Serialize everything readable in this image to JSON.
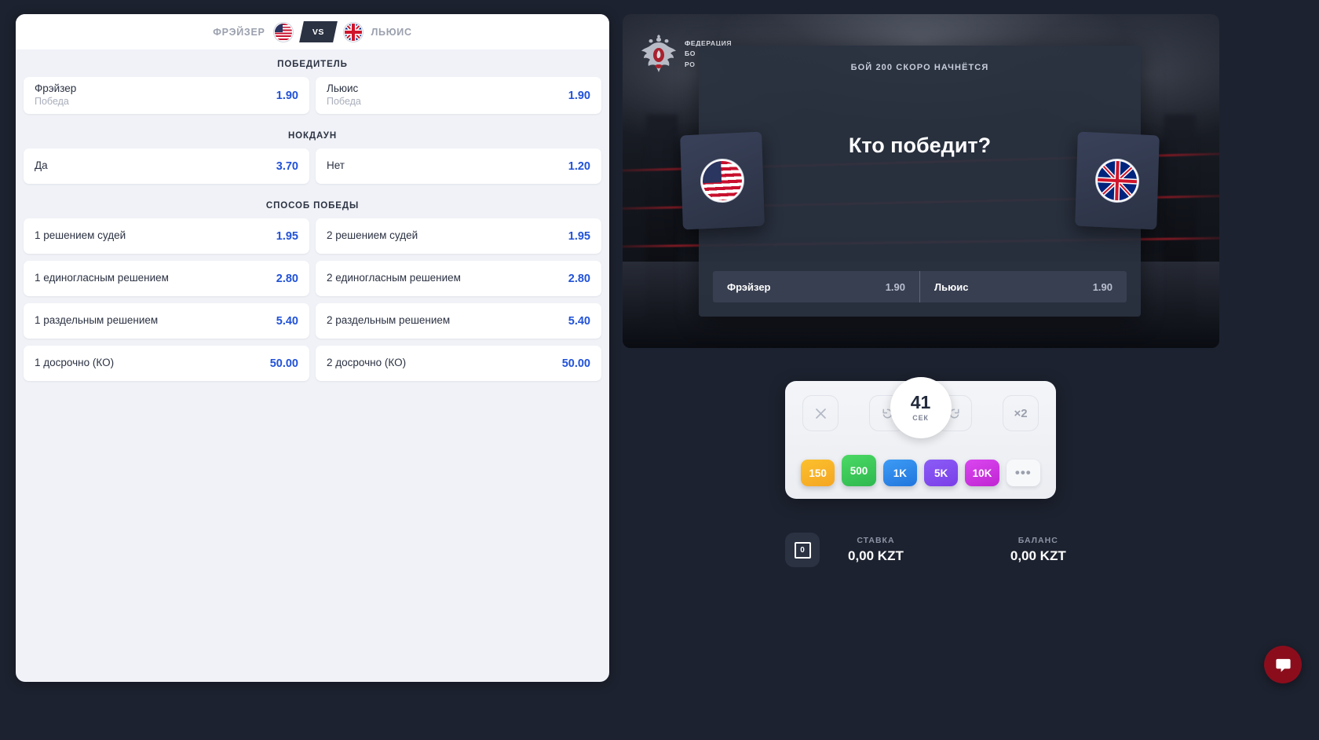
{
  "colors": {
    "accent_odds": "#2152d8",
    "panel_bg": "#f0f2f7",
    "dark_bg": "#1d2230",
    "overlay_bg": "#2a3140",
    "timer_ring": "#3dd13f",
    "chat_bubble": "#8b0d1c"
  },
  "bet_panel": {
    "header": {
      "fighter_left": "ФРЭЙЗЕР",
      "vs_label": "VS",
      "fighter_right": "ЛЬЮИС",
      "flag_left": "us-flag-icon",
      "flag_right": "uk-flag-icon"
    },
    "markets": [
      {
        "title": "ПОБЕДИТЕЛЬ",
        "rows": [
          [
            {
              "label": "Фрэйзер",
              "sub": "Победа",
              "odd": "1.90"
            },
            {
              "label": "Льюис",
              "sub": "Победа",
              "odd": "1.90"
            }
          ]
        ]
      },
      {
        "title": "НОКДАУН",
        "rows": [
          [
            {
              "label": "Да",
              "sub": "",
              "odd": "3.70"
            },
            {
              "label": "Нет",
              "sub": "",
              "odd": "1.20"
            }
          ]
        ]
      },
      {
        "title": "СПОСОБ ПОБЕДЫ",
        "rows": [
          [
            {
              "label": "1 решением судей",
              "sub": "",
              "odd": "1.95"
            },
            {
              "label": "2 решением судей",
              "sub": "",
              "odd": "1.95"
            }
          ],
          [
            {
              "label": "1 единогласным решением",
              "sub": "",
              "odd": "2.80"
            },
            {
              "label": "2 единогласным решением",
              "sub": "",
              "odd": "2.80"
            }
          ],
          [
            {
              "label": "1 раздельным решением",
              "sub": "",
              "odd": "5.40"
            },
            {
              "label": "2 раздельным решением",
              "sub": "",
              "odd": "5.40"
            }
          ],
          [
            {
              "label": "1 досрочно (КО)",
              "sub": "",
              "odd": "50.00"
            },
            {
              "label": "2 досрочно (КО)",
              "sub": "",
              "odd": "50.00"
            }
          ]
        ]
      }
    ]
  },
  "game": {
    "federation_logo": {
      "line1": "ФЕДЕРАЦИЯ",
      "line2": "БО",
      "line3": "РО",
      "emblem": "double-headed-eagle-icon"
    },
    "overlay": {
      "status_text": "БОЙ 200 СКОРО НАЧНЁТСЯ",
      "question": "Кто победит?",
      "card_left_flag": "us-flag-icon",
      "card_right_flag": "uk-flag-icon",
      "odds": [
        {
          "name": "Фрэйзер",
          "value": "1.90"
        },
        {
          "name": "Льюис",
          "value": "1.90"
        }
      ]
    }
  },
  "controls": {
    "clear_icon": "close-icon",
    "undo_icon": "undo-icon",
    "redo_icon": "redo-icon",
    "double_label": "×2",
    "timer": {
      "value": "41",
      "unit": "СЕК",
      "progress_percent": 68
    },
    "chips": [
      {
        "label": "150",
        "color_start": "#fbc02d",
        "color_end": "#f5a623",
        "selected": false
      },
      {
        "label": "500",
        "color_start": "#4cd964",
        "color_end": "#2eb84f",
        "selected": true
      },
      {
        "label": "1K",
        "color_start": "#3d9bf5",
        "color_end": "#2176dd",
        "selected": false
      },
      {
        "label": "5K",
        "color_start": "#8b5cf6",
        "color_end": "#7a3fe8",
        "selected": false
      },
      {
        "label": "10K",
        "color_start": "#d946ef",
        "color_end": "#c026d3",
        "selected": false
      },
      {
        "label": "•••",
        "color_start": "#f7f8fa",
        "color_end": "#f7f8fa",
        "selected": false
      }
    ]
  },
  "balance": {
    "coin_icon_label": "0",
    "stake_label": "СТАВКА",
    "stake_value": "0,00 KZT",
    "balance_label": "БАЛАНС",
    "balance_value": "0,00 KZT"
  },
  "chat": {
    "icon": "chat-bubble-icon"
  }
}
